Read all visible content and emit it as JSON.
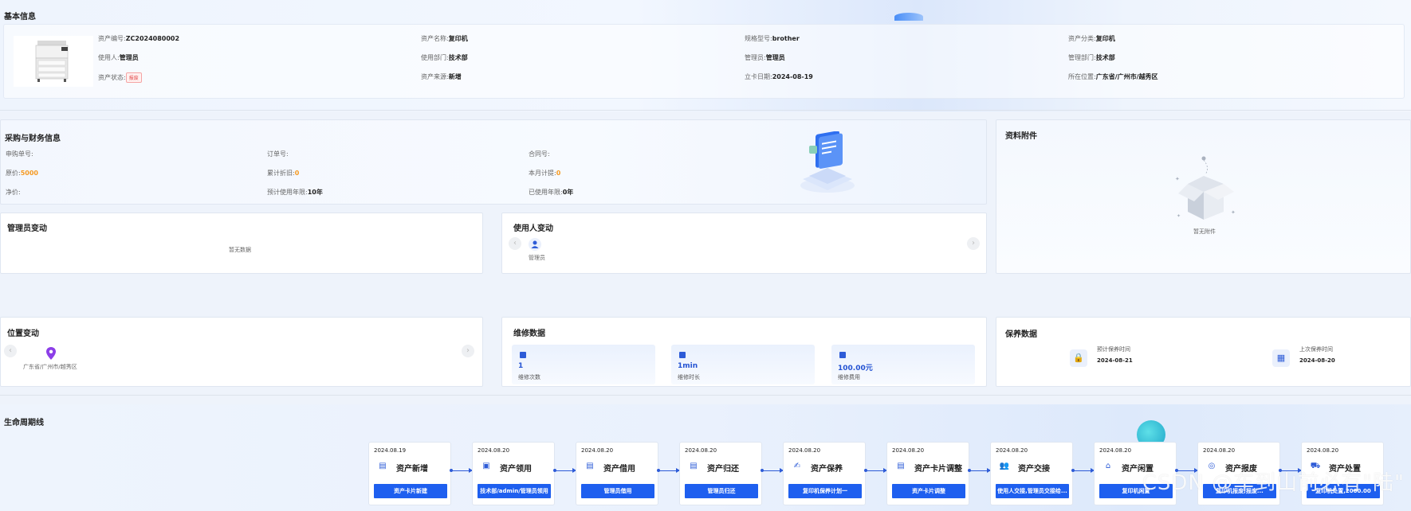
{
  "basic": {
    "title": "基本信息",
    "rows": [
      [
        {
          "label": "资产编号:",
          "value": "ZC2024080002"
        },
        {
          "label": "资产名称:",
          "value": "复印机"
        },
        {
          "label": "规格型号:",
          "value": "brother"
        },
        {
          "label": "资产分类:",
          "value": "复印机"
        }
      ],
      [
        {
          "label": "使用人:",
          "value": "管理员"
        },
        {
          "label": "使用部门:",
          "value": "技术部"
        },
        {
          "label": "管理员:",
          "value": "管理员"
        },
        {
          "label": "管理部门:",
          "value": "技术部"
        }
      ],
      [
        {
          "label": "资产状态:",
          "value": "报废"
        },
        {
          "label": "资产来源:",
          "value": "新增"
        },
        {
          "label": "立卡日期:",
          "value": "2024-08-19"
        },
        {
          "label": "所在位置:",
          "value": "广东省/广州市/越秀区"
        }
      ]
    ],
    "status_color": "#e34d4d"
  },
  "purchase": {
    "title": "采购与财务信息",
    "rows": [
      [
        {
          "label": "申购单号:",
          "value": ""
        },
        {
          "label": "订单号:",
          "value": ""
        },
        {
          "label": "合同号:",
          "value": ""
        }
      ],
      [
        {
          "label": "原价:",
          "value": "5000"
        },
        {
          "label": "累计折旧:",
          "value": "0"
        },
        {
          "label": "本月计提:",
          "value": "0"
        }
      ],
      [
        {
          "label": "净价:",
          "value": ""
        },
        {
          "label": "预计使用年限:",
          "value": "10年"
        },
        {
          "label": "已使用年限:",
          "value": "0年"
        }
      ]
    ]
  },
  "attachments": {
    "title": "资料附件",
    "empty": "暂无附件"
  },
  "admin_change": {
    "title": "管理员变动",
    "empty": "暂无数据"
  },
  "user_change": {
    "title": "使用人变动",
    "person": "管理员"
  },
  "location_change": {
    "title": "位置变动",
    "location": "广东省/广州市/越秀区"
  },
  "repair": {
    "title": "维修数据",
    "stats": [
      {
        "value": "1",
        "label": "维修次数"
      },
      {
        "value": "1min",
        "label": "维修时长"
      },
      {
        "value": "100.00元",
        "label": "维修费用"
      }
    ]
  },
  "maintenance": {
    "title": "保养数据",
    "items": [
      {
        "label": "预计保养时间",
        "value": "2024-08-21",
        "icon": "lock-icon"
      },
      {
        "label": "上次保养时间",
        "value": "2024-08-20",
        "icon": "calendar-icon"
      }
    ]
  },
  "lifecycle": {
    "title": "生命周期线",
    "steps": [
      {
        "date": "2024.08.19",
        "name": "资产新增",
        "button": "资产卡片新建"
      },
      {
        "date": "2024.08.20",
        "name": "资产领用",
        "button": "技术部/admin/管理员领用"
      },
      {
        "date": "2024.08.20",
        "name": "资产借用",
        "button": "管理员借用"
      },
      {
        "date": "2024.08.20",
        "name": "资产归还",
        "button": "管理员归还"
      },
      {
        "date": "2024.08.20",
        "name": "资产保养",
        "button": "复印机保养计划一"
      },
      {
        "date": "2024.08.20",
        "name": "资产卡片调整",
        "button": "资产卡片调整"
      },
      {
        "date": "2024.08.20",
        "name": "资产交接",
        "button": "使用人交接,管理员交接给..."
      },
      {
        "date": "2024.08.20",
        "name": "资产闲置",
        "button": "复印机闲置"
      },
      {
        "date": "2024.08.20",
        "name": "资产报废",
        "button": "复印机报废,报废..."
      },
      {
        "date": "2024.08.20",
        "name": "资产处置",
        "button": "复印机处置,2000.00"
      }
    ]
  },
  "watermark": "CSDN @车到山前必有\"陆\"",
  "colors": {
    "accent": "#1e5fef",
    "orange": "#f59a23"
  }
}
